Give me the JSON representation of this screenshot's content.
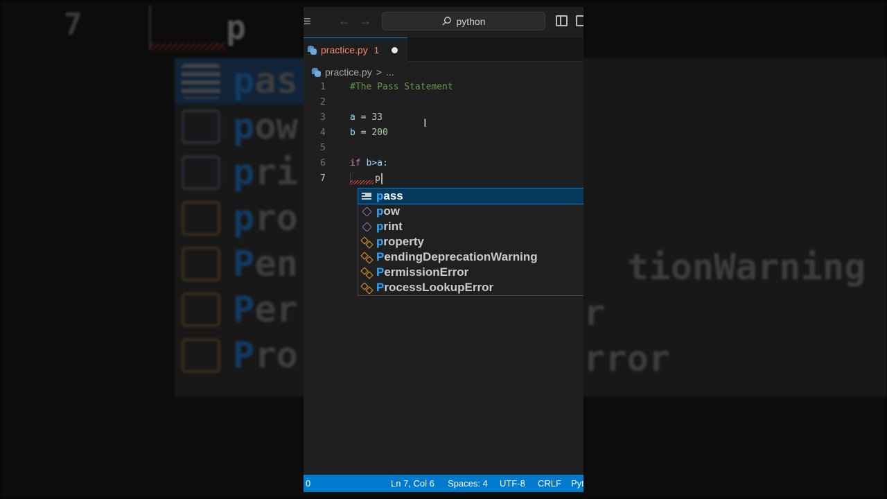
{
  "background": {
    "line_number": "7",
    "caret_char": "p",
    "suggestions_zoomed": [
      {
        "match": "p",
        "rest": "as",
        "selected": true
      },
      {
        "match": "p",
        "rest": "ow"
      },
      {
        "match": "p",
        "rest": "ri"
      },
      {
        "match": "p",
        "rest": "ro"
      },
      {
        "match": "P",
        "rest": "en"
      },
      {
        "match": "P",
        "rest": "er"
      },
      {
        "match": "P",
        "rest": "ro"
      }
    ],
    "right_fragments": [
      "tionWarning",
      "r",
      "rror"
    ]
  },
  "titlebar": {
    "menu_icon": "menu-icon",
    "back_icon": "arrow-left-icon",
    "forward_icon": "arrow-right-icon",
    "search_text": "python"
  },
  "tab": {
    "filename": "practice.py",
    "problem_count": "1",
    "modified": true
  },
  "breadcrumb": {
    "file": "practice.py",
    "separator": ">",
    "ellipsis": "..."
  },
  "editor": {
    "lines": [
      {
        "n": "1",
        "text": "#The Pass Statement"
      },
      {
        "n": "2",
        "text": ""
      },
      {
        "n": "3",
        "text": "a = 33"
      },
      {
        "n": "4",
        "text": "b = 200"
      },
      {
        "n": "5",
        "text": ""
      },
      {
        "n": "6",
        "text": "if b>a:"
      },
      {
        "n": "7",
        "text": "    p"
      }
    ],
    "l3": {
      "var": "a",
      "op": " = ",
      "num": "33"
    },
    "l4": {
      "var": "b",
      "op": " = ",
      "num": "200"
    },
    "l6": {
      "kw": "if",
      "rest": " b>a:"
    },
    "l7": {
      "typed": "p"
    }
  },
  "suggestions": [
    {
      "kind": "keyword",
      "match": "p",
      "rest": "ass",
      "selected": true
    },
    {
      "kind": "method",
      "match": "p",
      "rest": "ow"
    },
    {
      "kind": "method",
      "match": "p",
      "rest": "rint"
    },
    {
      "kind": "class",
      "match": "p",
      "rest": "roperty"
    },
    {
      "kind": "class",
      "match": "P",
      "rest": "endingDeprecationWarning"
    },
    {
      "kind": "class",
      "match": "P",
      "rest": "ermissionError"
    },
    {
      "kind": "class",
      "match": "P",
      "rest": "rocessLookupError"
    }
  ],
  "statusbar": {
    "errors": "0",
    "position": "Ln 7, Col 6",
    "spaces": "Spaces: 4",
    "encoding": "UTF-8",
    "eol": "CRLF",
    "language": "Pyt"
  },
  "colors": {
    "accent": "#007acc",
    "selection": "#04395e",
    "match": "#2aaaff",
    "error_tab": "#f48771"
  }
}
